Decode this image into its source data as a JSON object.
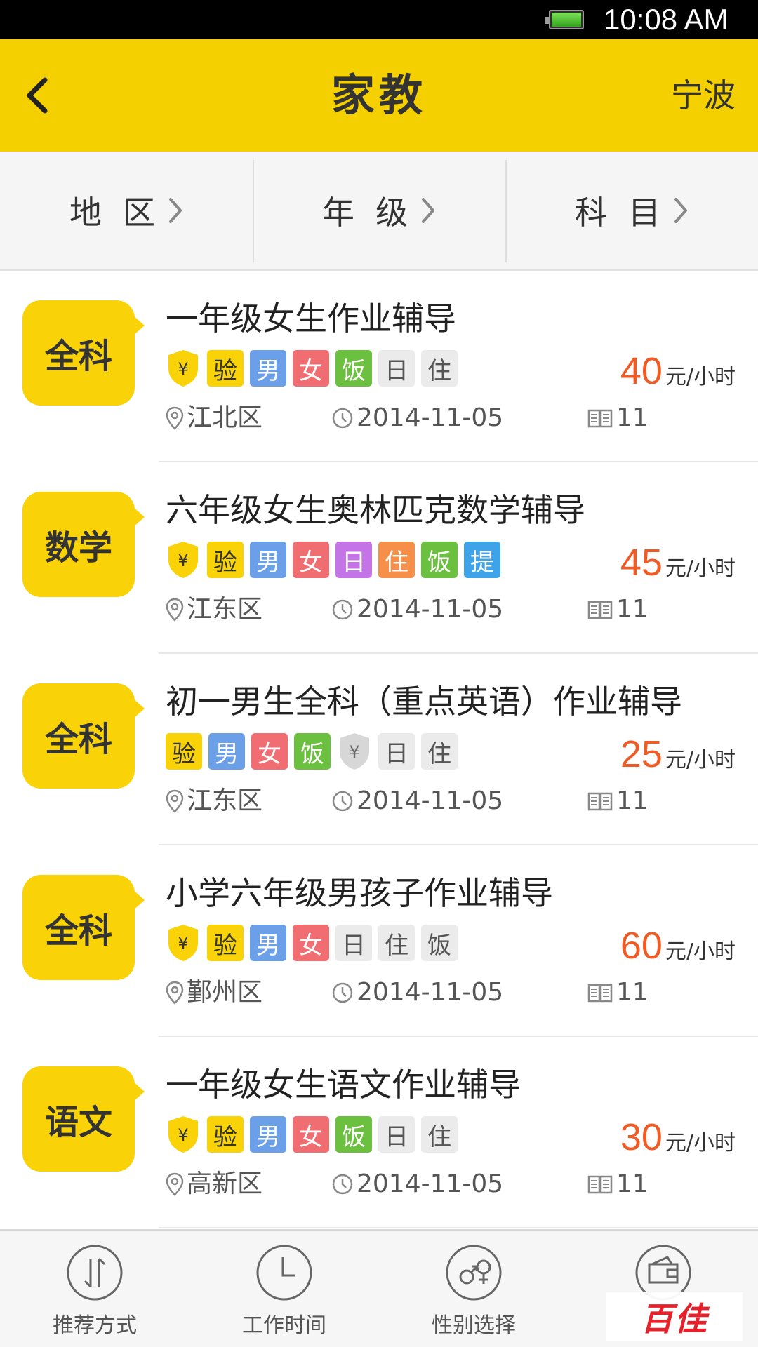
{
  "status_bar": {
    "time": "10:08 AM"
  },
  "header": {
    "title": "家教",
    "city": "宁波"
  },
  "filters": [
    {
      "label": "地区"
    },
    {
      "label": "年级"
    },
    {
      "label": "科目"
    }
  ],
  "colors": {
    "header_yellow": "#f5d000",
    "subject_yellow": "#f9d308",
    "price_orange": "#f05a24",
    "tag_yan": "#f9d308",
    "tag_male": "#6b9fe8",
    "tag_female": "#f06d72",
    "tag_fan": "#6cc040",
    "tag_ri_purple": "#c574e8",
    "tag_zhu_orange": "#f58f4a",
    "tag_ti_blue": "#3ea3e8",
    "tag_plain": "#ebebeb"
  },
  "listings": [
    {
      "subject": "全科",
      "title": "一年级女生作业辅导",
      "tags": [
        {
          "type": "shield-gold"
        },
        {
          "text": "验",
          "color": "#f9d308"
        },
        {
          "text": "男",
          "color": "#6b9fe8"
        },
        {
          "text": "女",
          "color": "#f06d72"
        },
        {
          "text": "饭",
          "color": "#6cc040"
        },
        {
          "text": "日",
          "color": "plain"
        },
        {
          "text": "住",
          "color": "plain"
        }
      ],
      "price": "40",
      "unit": "元/小时",
      "area": "江北区",
      "date": "2014-11-05",
      "count": "11"
    },
    {
      "subject": "数学",
      "title": "六年级女生奥林匹克数学辅导",
      "tags": [
        {
          "type": "shield-gold"
        },
        {
          "text": "验",
          "color": "#f9d308"
        },
        {
          "text": "男",
          "color": "#6b9fe8"
        },
        {
          "text": "女",
          "color": "#f06d72"
        },
        {
          "text": "日",
          "color": "#c574e8"
        },
        {
          "text": "住",
          "color": "#f58f4a"
        },
        {
          "text": "饭",
          "color": "#6cc040"
        },
        {
          "text": "提",
          "color": "#3ea3e8"
        }
      ],
      "price": "45",
      "unit": "元/小时",
      "area": "江东区",
      "date": "2014-11-05",
      "count": "11"
    },
    {
      "subject": "全科",
      "title": "初一男生全科（重点英语）作业辅导",
      "tags": [
        {
          "text": "验",
          "color": "#f9d308"
        },
        {
          "text": "男",
          "color": "#6b9fe8"
        },
        {
          "text": "女",
          "color": "#f06d72"
        },
        {
          "text": "饭",
          "color": "#6cc040"
        },
        {
          "type": "shield-gray"
        },
        {
          "text": "日",
          "color": "plain"
        },
        {
          "text": "住",
          "color": "plain"
        }
      ],
      "price": "25",
      "unit": "元/小时",
      "area": "江东区",
      "date": "2014-11-05",
      "count": "11"
    },
    {
      "subject": "全科",
      "title": "小学六年级男孩子作业辅导",
      "tags": [
        {
          "type": "shield-gold"
        },
        {
          "text": "验",
          "color": "#f9d308"
        },
        {
          "text": "男",
          "color": "#6b9fe8"
        },
        {
          "text": "女",
          "color": "#f06d72"
        },
        {
          "text": "日",
          "color": "plain"
        },
        {
          "text": "住",
          "color": "plain"
        },
        {
          "text": "饭",
          "color": "plain"
        }
      ],
      "price": "60",
      "unit": "元/小时",
      "area": "鄞州区",
      "date": "2014-11-05",
      "count": "11"
    },
    {
      "subject": "语文",
      "title": "一年级女生语文作业辅导",
      "tags": [
        {
          "type": "shield-gold"
        },
        {
          "text": "验",
          "color": "#f9d308"
        },
        {
          "text": "男",
          "color": "#6b9fe8"
        },
        {
          "text": "女",
          "color": "#f06d72"
        },
        {
          "text": "饭",
          "color": "#6cc040"
        },
        {
          "text": "日",
          "color": "plain"
        },
        {
          "text": "住",
          "color": "plain"
        }
      ],
      "price": "30",
      "unit": "元/小时",
      "area": "高新区",
      "date": "2014-11-05",
      "count": "11"
    }
  ],
  "tabbar": [
    {
      "label": "推荐方式",
      "icon": "sort-arrows-icon"
    },
    {
      "label": "工作时间",
      "icon": "clock-icon"
    },
    {
      "label": "性别选择",
      "icon": "gender-icon"
    },
    {
      "label": "",
      "icon": "wallet-icon"
    }
  ],
  "watermark": "百佳"
}
